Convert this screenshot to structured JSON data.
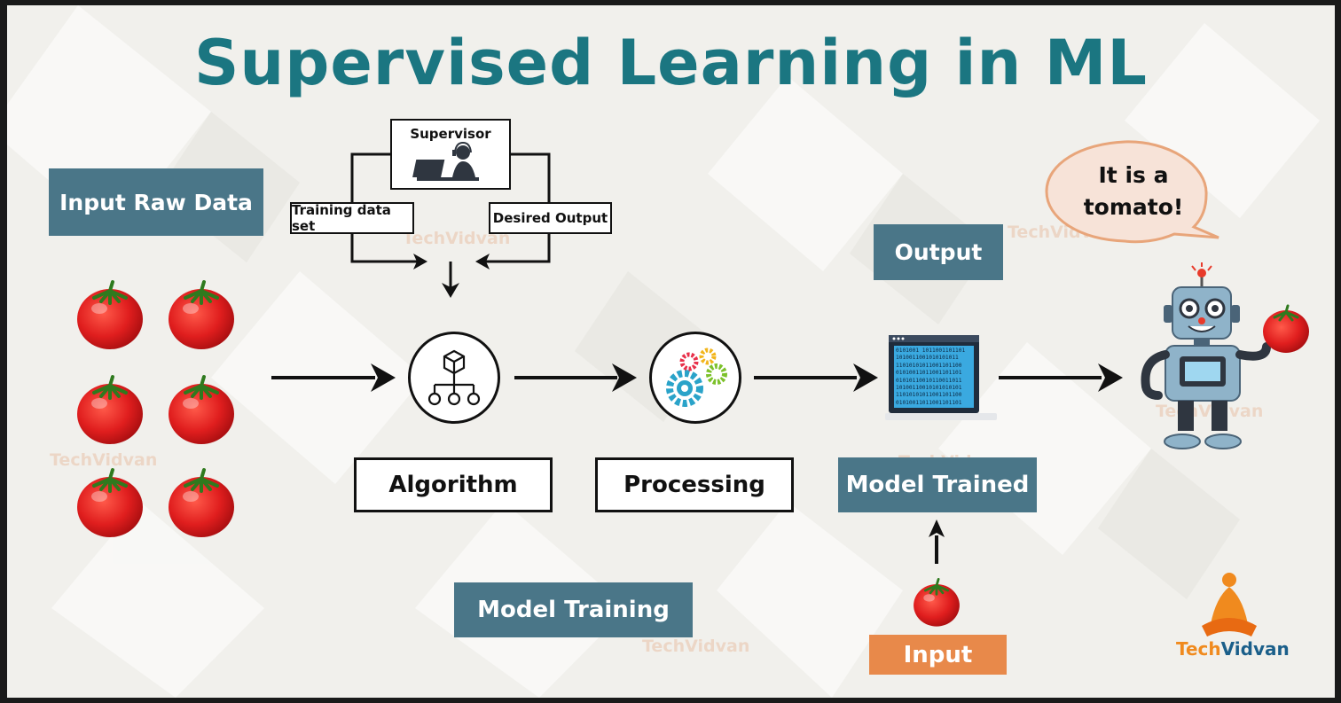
{
  "title": "Supervised Learning in ML",
  "labels": {
    "input_raw_data": "Input Raw Data",
    "supervisor": "Supervisor",
    "training_data_set": "Training data set",
    "desired_output": "Desired Output",
    "algorithm": "Algorithm",
    "processing": "Processing",
    "model_trained": "Model Trained",
    "model_training": "Model Training",
    "output": "Output",
    "input": "Input"
  },
  "speech_bubble": {
    "line1": "It is a",
    "line2": "tomato!"
  },
  "brand": {
    "part1": "Tech",
    "part2": "Vidvan"
  },
  "binary_rows": [
    "0101001 1011001101101",
    "1010011001010101011",
    "11010101011001101100",
    "01010011011001101101",
    "01010110010110011011",
    "10100110010101010101",
    "11010101011001101100",
    "01010011011001101101"
  ],
  "colors": {
    "title": "#1b7681",
    "teal_box": "#4a7688",
    "input_box": "#e8894a",
    "bubble": "#f7e3d8",
    "tomato": "#e02020"
  },
  "icons": [
    "tomato-icon",
    "supervisor-icon",
    "algorithm-hierarchy-icon",
    "gears-icon",
    "laptop-binary-icon",
    "robot-icon",
    "speech-bubble-icon",
    "techvidvan-logo-icon"
  ]
}
